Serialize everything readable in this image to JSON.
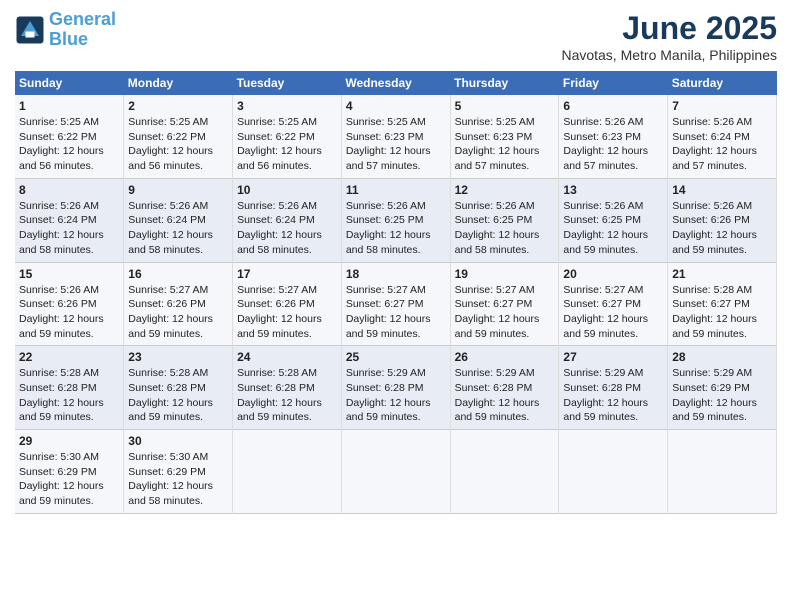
{
  "logo": {
    "line1": "General",
    "line2": "Blue"
  },
  "title": "June 2025",
  "location": "Navotas, Metro Manila, Philippines",
  "days_of_week": [
    "Sunday",
    "Monday",
    "Tuesday",
    "Wednesday",
    "Thursday",
    "Friday",
    "Saturday"
  ],
  "weeks": [
    [
      {
        "num": "1",
        "sunrise": "5:25 AM",
        "sunset": "6:22 PM",
        "daylight": "12 hours and 56 minutes."
      },
      {
        "num": "2",
        "sunrise": "5:25 AM",
        "sunset": "6:22 PM",
        "daylight": "12 hours and 56 minutes."
      },
      {
        "num": "3",
        "sunrise": "5:25 AM",
        "sunset": "6:22 PM",
        "daylight": "12 hours and 56 minutes."
      },
      {
        "num": "4",
        "sunrise": "5:25 AM",
        "sunset": "6:23 PM",
        "daylight": "12 hours and 57 minutes."
      },
      {
        "num": "5",
        "sunrise": "5:25 AM",
        "sunset": "6:23 PM",
        "daylight": "12 hours and 57 minutes."
      },
      {
        "num": "6",
        "sunrise": "5:26 AM",
        "sunset": "6:23 PM",
        "daylight": "12 hours and 57 minutes."
      },
      {
        "num": "7",
        "sunrise": "5:26 AM",
        "sunset": "6:24 PM",
        "daylight": "12 hours and 57 minutes."
      }
    ],
    [
      {
        "num": "8",
        "sunrise": "5:26 AM",
        "sunset": "6:24 PM",
        "daylight": "12 hours and 58 minutes."
      },
      {
        "num": "9",
        "sunrise": "5:26 AM",
        "sunset": "6:24 PM",
        "daylight": "12 hours and 58 minutes."
      },
      {
        "num": "10",
        "sunrise": "5:26 AM",
        "sunset": "6:24 PM",
        "daylight": "12 hours and 58 minutes."
      },
      {
        "num": "11",
        "sunrise": "5:26 AM",
        "sunset": "6:25 PM",
        "daylight": "12 hours and 58 minutes."
      },
      {
        "num": "12",
        "sunrise": "5:26 AM",
        "sunset": "6:25 PM",
        "daylight": "12 hours and 58 minutes."
      },
      {
        "num": "13",
        "sunrise": "5:26 AM",
        "sunset": "6:25 PM",
        "daylight": "12 hours and 59 minutes."
      },
      {
        "num": "14",
        "sunrise": "5:26 AM",
        "sunset": "6:26 PM",
        "daylight": "12 hours and 59 minutes."
      }
    ],
    [
      {
        "num": "15",
        "sunrise": "5:26 AM",
        "sunset": "6:26 PM",
        "daylight": "12 hours and 59 minutes."
      },
      {
        "num": "16",
        "sunrise": "5:27 AM",
        "sunset": "6:26 PM",
        "daylight": "12 hours and 59 minutes."
      },
      {
        "num": "17",
        "sunrise": "5:27 AM",
        "sunset": "6:26 PM",
        "daylight": "12 hours and 59 minutes."
      },
      {
        "num": "18",
        "sunrise": "5:27 AM",
        "sunset": "6:27 PM",
        "daylight": "12 hours and 59 minutes."
      },
      {
        "num": "19",
        "sunrise": "5:27 AM",
        "sunset": "6:27 PM",
        "daylight": "12 hours and 59 minutes."
      },
      {
        "num": "20",
        "sunrise": "5:27 AM",
        "sunset": "6:27 PM",
        "daylight": "12 hours and 59 minutes."
      },
      {
        "num": "21",
        "sunrise": "5:28 AM",
        "sunset": "6:27 PM",
        "daylight": "12 hours and 59 minutes."
      }
    ],
    [
      {
        "num": "22",
        "sunrise": "5:28 AM",
        "sunset": "6:28 PM",
        "daylight": "12 hours and 59 minutes."
      },
      {
        "num": "23",
        "sunrise": "5:28 AM",
        "sunset": "6:28 PM",
        "daylight": "12 hours and 59 minutes."
      },
      {
        "num": "24",
        "sunrise": "5:28 AM",
        "sunset": "6:28 PM",
        "daylight": "12 hours and 59 minutes."
      },
      {
        "num": "25",
        "sunrise": "5:29 AM",
        "sunset": "6:28 PM",
        "daylight": "12 hours and 59 minutes."
      },
      {
        "num": "26",
        "sunrise": "5:29 AM",
        "sunset": "6:28 PM",
        "daylight": "12 hours and 59 minutes."
      },
      {
        "num": "27",
        "sunrise": "5:29 AM",
        "sunset": "6:28 PM",
        "daylight": "12 hours and 59 minutes."
      },
      {
        "num": "28",
        "sunrise": "5:29 AM",
        "sunset": "6:29 PM",
        "daylight": "12 hours and 59 minutes."
      }
    ],
    [
      {
        "num": "29",
        "sunrise": "5:30 AM",
        "sunset": "6:29 PM",
        "daylight": "12 hours and 59 minutes."
      },
      {
        "num": "30",
        "sunrise": "5:30 AM",
        "sunset": "6:29 PM",
        "daylight": "12 hours and 58 minutes."
      },
      null,
      null,
      null,
      null,
      null
    ]
  ]
}
